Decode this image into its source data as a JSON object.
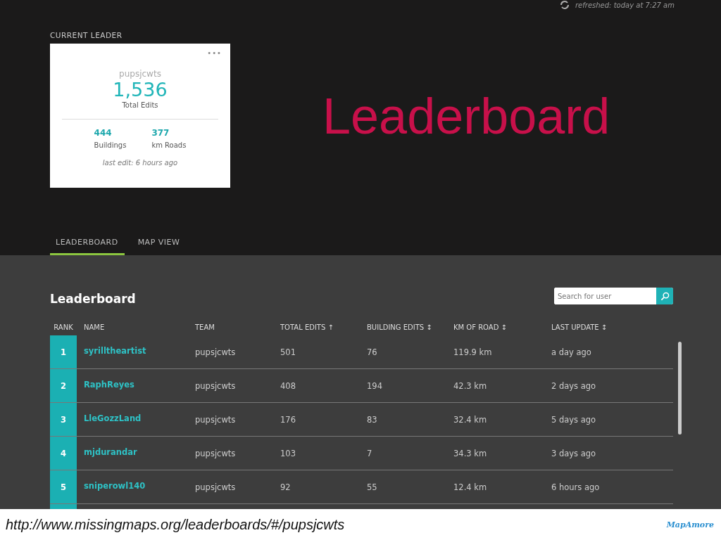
{
  "refreshed": "refreshed: today at 7:27 am",
  "leader": {
    "heading": "CURRENT LEADER",
    "menu": "•••",
    "team": "pupsjcwts",
    "total": "1,536",
    "total_label": "Total Edits",
    "stats": [
      {
        "value": "444",
        "label": "Buildings"
      },
      {
        "value": "377",
        "label": "km Roads"
      }
    ],
    "last_edit": "last edit: 6 hours ago"
  },
  "slide_title": "Leaderboard",
  "tabs": [
    {
      "label": "LEADERBOARD",
      "selected": true
    },
    {
      "label": "MAP VIEW",
      "selected": false
    }
  ],
  "board": {
    "title": "Leaderboard",
    "search": {
      "placeholder": "Search for user"
    },
    "columns": [
      "RANK",
      "NAME",
      "TEAM",
      "TOTAL EDITS ↑",
      "BUILDING EDITS ↕",
      "KM OF ROAD ↕",
      "LAST UPDATE ↕"
    ],
    "rows": [
      {
        "rank": "1",
        "name": "syrilltheartist",
        "team": "pupsjcwts",
        "total": "501",
        "buildings": "76",
        "road": "119.9 km",
        "updated": "a day ago"
      },
      {
        "rank": "2",
        "name": "RaphReyes",
        "team": "pupsjcwts",
        "total": "408",
        "buildings": "194",
        "road": "42.3 km",
        "updated": "2 days ago"
      },
      {
        "rank": "3",
        "name": "LleGozzLand",
        "team": "pupsjcwts",
        "total": "176",
        "buildings": "83",
        "road": "32.4 km",
        "updated": "5 days ago"
      },
      {
        "rank": "4",
        "name": "mjdurandar",
        "team": "pupsjcwts",
        "total": "103",
        "buildings": "7",
        "road": "34.3 km",
        "updated": "3 days ago"
      },
      {
        "rank": "5",
        "name": "sniperowl140",
        "team": "pupsjcwts",
        "total": "92",
        "buildings": "55",
        "road": "12.4 km",
        "updated": "6 hours ago"
      }
    ]
  },
  "footer": {
    "url": "http://www.missingmaps.org/leaderboards/#/pupsjcwts",
    "logo": "MapAmore"
  }
}
